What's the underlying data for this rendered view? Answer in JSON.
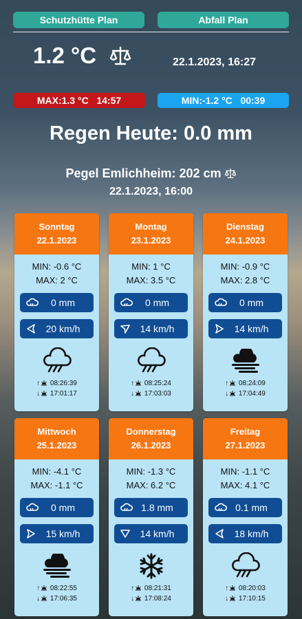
{
  "header": {
    "btn_left": "Schutzhütte Plan",
    "btn_right": "Abfall Plan",
    "temperature": "1.2 °C",
    "datetime": "22.1.2023, 16:27",
    "max": "MAX:1.3 °C   14:57",
    "min": "MIN:-1.2 °C   00:39",
    "rain_today": "Regen Heute: 0.0 mm",
    "pegel": "Pegel Emlichheim: 202 cm",
    "pegel_time": "22.1.2023, 16:00"
  },
  "colors": {
    "teal": "#2fa89a",
    "max_red": "#c3171a",
    "min_blue": "#1ba4ef",
    "card_header_orange": "#f67612",
    "card_bg": "#b9e4f6",
    "card_box_navy": "#104d94"
  },
  "days": [
    {
      "name": "Sonntag",
      "date": "22.1.2023",
      "min": "MIN: -0.6 °C",
      "max": "MAX: 2 °C",
      "rain": "0 mm",
      "wind": "20 km/h",
      "wind_icon": "wind-direction-left-icon",
      "weather_icon": "rain-cloud-icon",
      "sunrise": "08:26:39",
      "sunset": "17:01:17"
    },
    {
      "name": "Montag",
      "date": "23.1.2023",
      "min": "MIN: 1 °C",
      "max": "MAX: 3.5 °C",
      "rain": "0 mm",
      "wind": "14 km/h",
      "wind_icon": "wind-direction-up-right-icon",
      "weather_icon": "rain-cloud-icon",
      "sunrise": "08:25:24",
      "sunset": "17:03:03"
    },
    {
      "name": "Dienstag",
      "date": "24.1.2023",
      "min": "MIN: -0.9 °C",
      "max": "MAX: 2.8 °C",
      "rain": "0 mm",
      "wind": "14 km/h",
      "wind_icon": "wind-direction-right-icon",
      "weather_icon": "fog-cloud-icon",
      "sunrise": "08:24:09",
      "sunset": "17:04:49"
    },
    {
      "name": "Mittwoch",
      "date": "25.1.2023",
      "min": "MIN: -4.1 °C",
      "max": "MAX: -1.1 °C",
      "rain": "0 mm",
      "wind": "15 km/h",
      "wind_icon": "wind-direction-right-icon",
      "weather_icon": "fog-cloud-icon",
      "sunrise": "08:22:55",
      "sunset": "17:06:35"
    },
    {
      "name": "Donnerstag",
      "date": "26.1.2023",
      "min": "MIN: -1.3 °C",
      "max": "MAX: 6.2 °C",
      "rain": "1.8 mm",
      "wind": "14 km/h",
      "wind_icon": "wind-direction-down-icon",
      "weather_icon": "snowflake-icon",
      "sunrise": "08:21:31",
      "sunset": "17:08:24"
    },
    {
      "name": "Freitag",
      "date": "27.1.2023",
      "min": "MIN: -1.1 °C",
      "max": "MAX: 4.1 °C",
      "rain": "0.1 mm",
      "wind": "18 km/h",
      "wind_icon": "wind-direction-left-icon",
      "weather_icon": "rain-cloud-icon",
      "sunrise": "08:20:03",
      "sunset": "17:10:15"
    }
  ]
}
